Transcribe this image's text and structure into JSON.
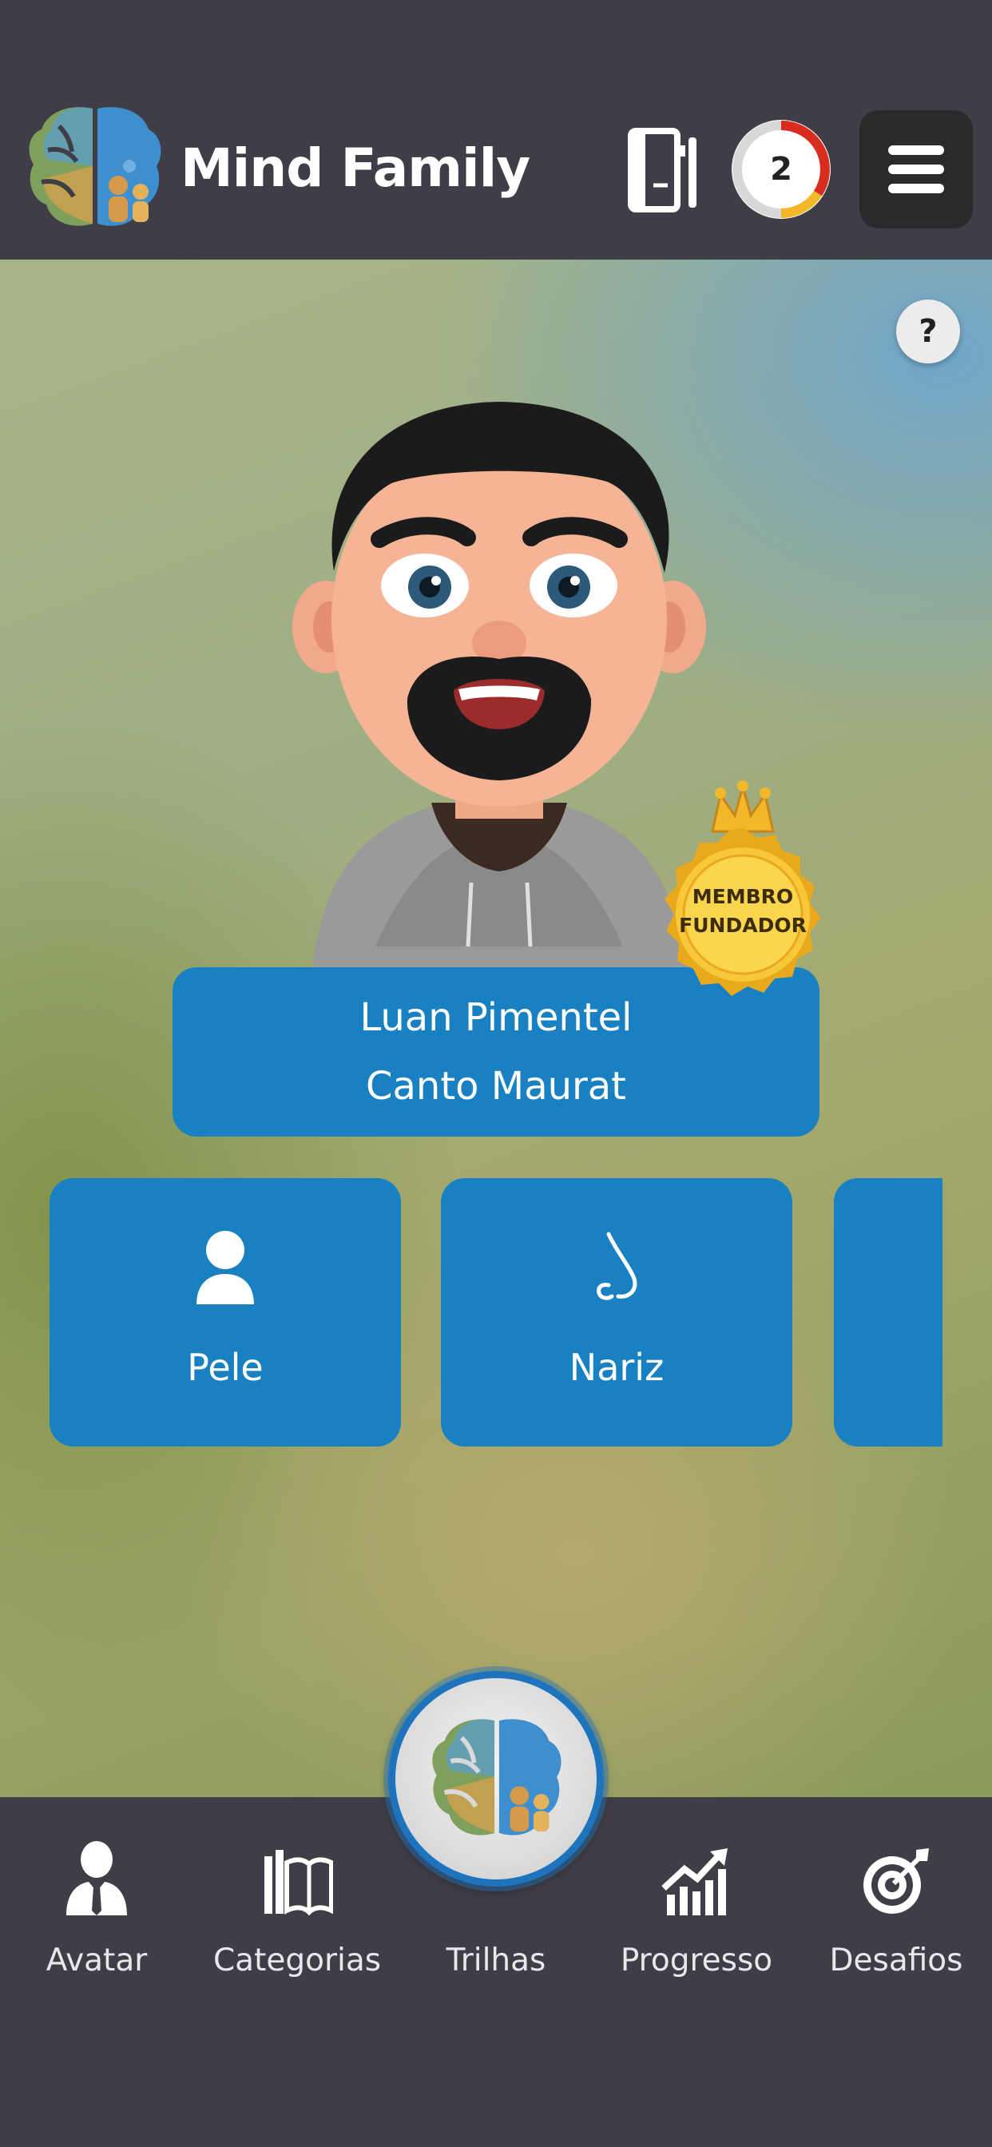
{
  "header": {
    "brand": "Mind Family",
    "level_badge": "2",
    "icons": [
      "brain-family-logo-icon",
      "notebook-icon",
      "level-ring-icon",
      "hamburger-menu-icon"
    ]
  },
  "main": {
    "help_label": "?",
    "badge": {
      "line1": "MEMBRO",
      "line2": "FUNDADOR"
    },
    "user": {
      "name_line1": "Luan Pimentel",
      "name_line2": "Canto Maurat"
    },
    "options": [
      {
        "label": "Pele",
        "icon": "person-icon"
      },
      {
        "label": "Nariz",
        "icon": "nose-icon"
      }
    ]
  },
  "bottom_nav": {
    "items": [
      {
        "label": "Avatar",
        "icon": "user-tie-icon"
      },
      {
        "label": "Categorias",
        "icon": "books-icon"
      },
      {
        "label": "Trilhas",
        "icon": "brain-logo-icon"
      },
      {
        "label": "Progresso",
        "icon": "growth-chart-icon"
      },
      {
        "label": "Desafios",
        "icon": "target-icon"
      }
    ]
  },
  "colors": {
    "header_bg": "#3f3e47",
    "card_blue": "#1981c2",
    "menu_button_bg": "#2a2a2c",
    "ring_accent": "#d92c1f",
    "badge_gold": "#f2c230"
  }
}
